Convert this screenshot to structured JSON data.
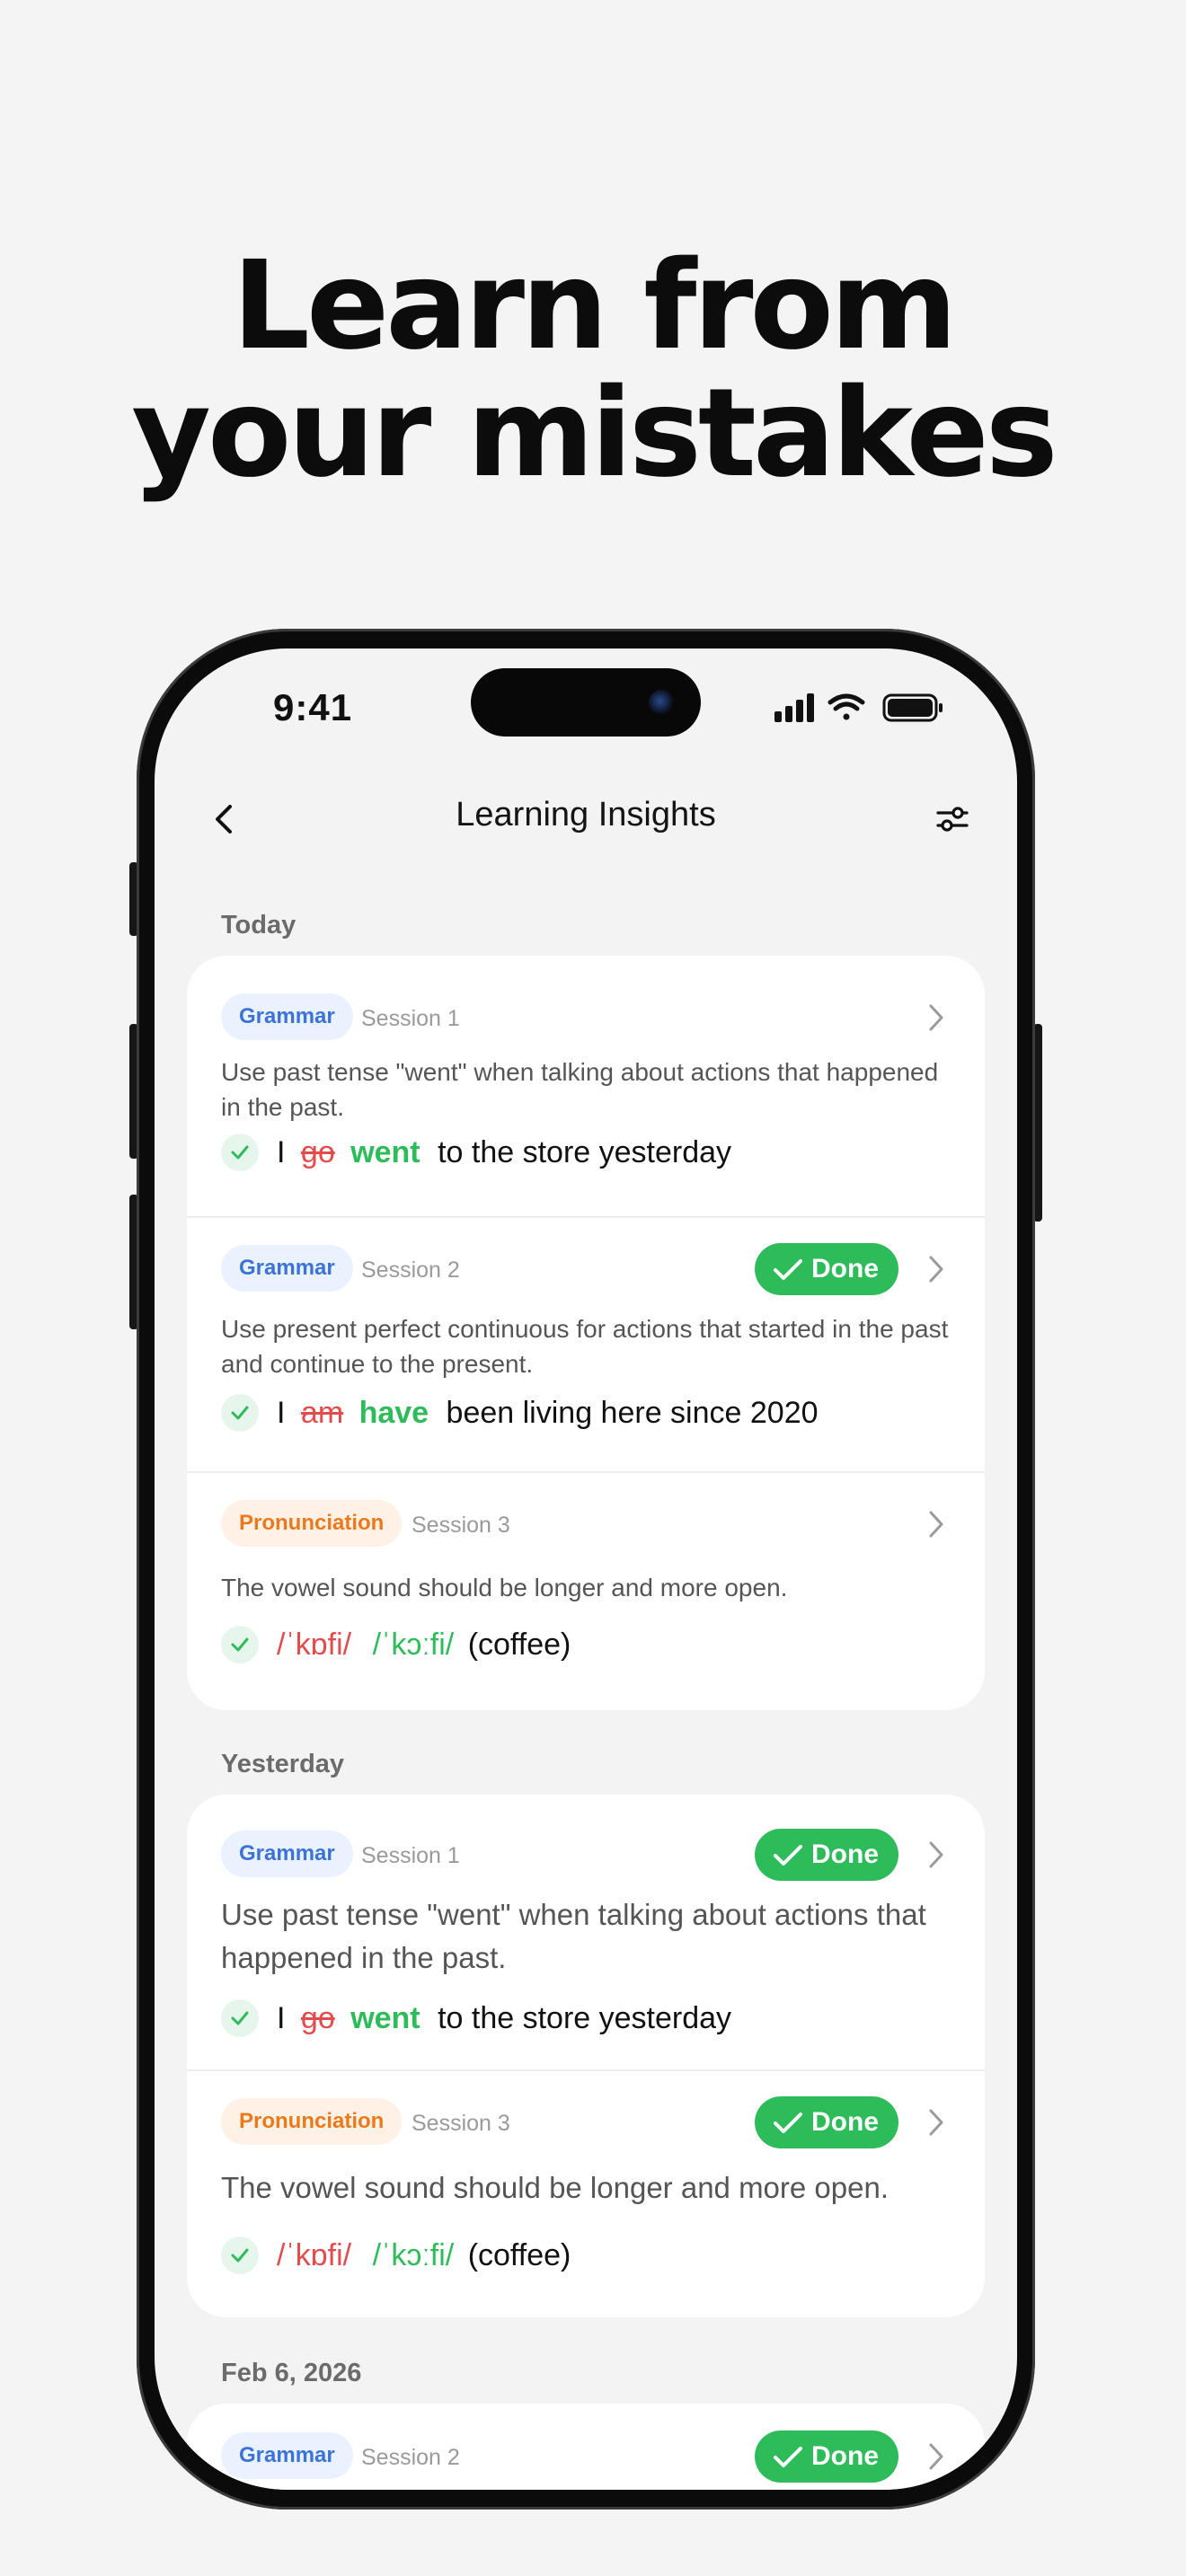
{
  "headline": {
    "line1": "Learn from",
    "line2": "your mistakes"
  },
  "status_bar": {
    "time": "9:41"
  },
  "nav": {
    "title": "Learning Insights"
  },
  "colors": {
    "grammar_tag": "#3b73d8",
    "pronunciation_tag": "#ea7a1c",
    "done_badge": "#2ebc5b",
    "wrong_text": "#e24c4c",
    "correct_text": "#2ebc5b"
  },
  "sections": [
    {
      "label": "Today",
      "entries": [
        {
          "tag": "Grammar",
          "session": "Session 1",
          "done": "",
          "description": "Use past tense \"went\" when talking about actions that happened in the past.",
          "example": {
            "prefix": "I",
            "wrong": "go",
            "correct": "went",
            "rest": "to the store yesterday"
          }
        },
        {
          "tag": "Grammar",
          "session": "Session 2",
          "done": "Done",
          "description": "Use present perfect continuous for actions that started in the past and continue to the present.",
          "example": {
            "prefix": "I",
            "wrong": "am",
            "correct": "have",
            "rest": "been living here since 2020"
          }
        },
        {
          "tag": "Pronunciation",
          "session": "Session 3",
          "done": "",
          "description": "The vowel sound should be longer and more open.",
          "example": {
            "wrong": "/ˈkɒfi/",
            "correct": "/ˈkɔːfi/",
            "rest": "(coffee)"
          }
        }
      ]
    },
    {
      "label": "Yesterday",
      "entries": [
        {
          "tag": "Grammar",
          "session": "Session 1",
          "done": "Done",
          "description": "Use past tense \"went\" when talking about actions that happened in the past.",
          "example": {
            "prefix": "I",
            "wrong": "go",
            "correct": "went",
            "rest": "to the store yesterday"
          }
        },
        {
          "tag": "Pronunciation",
          "session": "Session 3",
          "done": "Done",
          "description": "The vowel sound should be longer and more open.",
          "example": {
            "wrong": "/ˈkɒfi/",
            "correct": "/ˈkɔːfi/",
            "rest": "(coffee)"
          }
        }
      ]
    },
    {
      "label": "Feb 6, 2026",
      "entries": [
        {
          "tag": "Grammar",
          "session": "Session 2",
          "done": "Done"
        }
      ]
    }
  ],
  "icons": {
    "back": "chevron-left-icon",
    "filter": "sliders-icon",
    "done": "checkmark-icon",
    "row": "chevron-right-icon",
    "example": "check-circle-icon"
  }
}
